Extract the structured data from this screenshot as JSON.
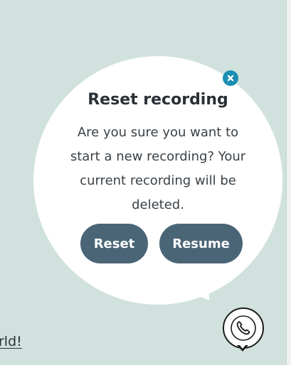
{
  "background": {
    "link_text": "rld!",
    "color": "#d1e2de"
  },
  "dialog": {
    "title": "Reset recording",
    "message": "Are you sure you want to start a new recording? Your current recording will be deleted.",
    "close_icon": "close-icon",
    "reset_label": "Reset",
    "resume_label": "Resume",
    "button_color": "#4a6576",
    "close_color": "#1b8fb3"
  },
  "widget": {
    "icon": "phone-icon"
  }
}
